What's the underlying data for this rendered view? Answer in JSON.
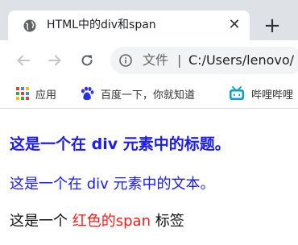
{
  "tab": {
    "title": "HTML中的div和span",
    "close_glyph": "✕",
    "favicon": "globe-icon"
  },
  "newtab": {
    "glyph": "+"
  },
  "toolbar": {
    "back_icon": "arrow-left-icon",
    "forward_icon": "arrow-right-icon",
    "reload_icon": "reload-icon"
  },
  "address_bar": {
    "site_chip": "文件",
    "separator": "|",
    "url": "C:/Users/lenovo/"
  },
  "bookmarks": [
    {
      "label": "应用",
      "icon": "apps-grid-icon"
    },
    {
      "label": "百度一下，你就知道",
      "icon": "baidu-paw-icon"
    },
    {
      "label": "哔哩哔哩",
      "icon": "bilibili-tv-icon"
    }
  ],
  "page": {
    "heading": "这是一个在 div 元素中的标题。",
    "div_text": "这是一个在 div 元素中的文本。",
    "span_before": "这是一个 ",
    "span_red": "红色的span",
    "span_after": " 标签"
  },
  "colors": {
    "blue_text": "#1a1aff",
    "red_span": "#ff1a1a",
    "tabstrip_bg": "#dee1e6",
    "omnibox_bg": "#f1f3f4"
  }
}
